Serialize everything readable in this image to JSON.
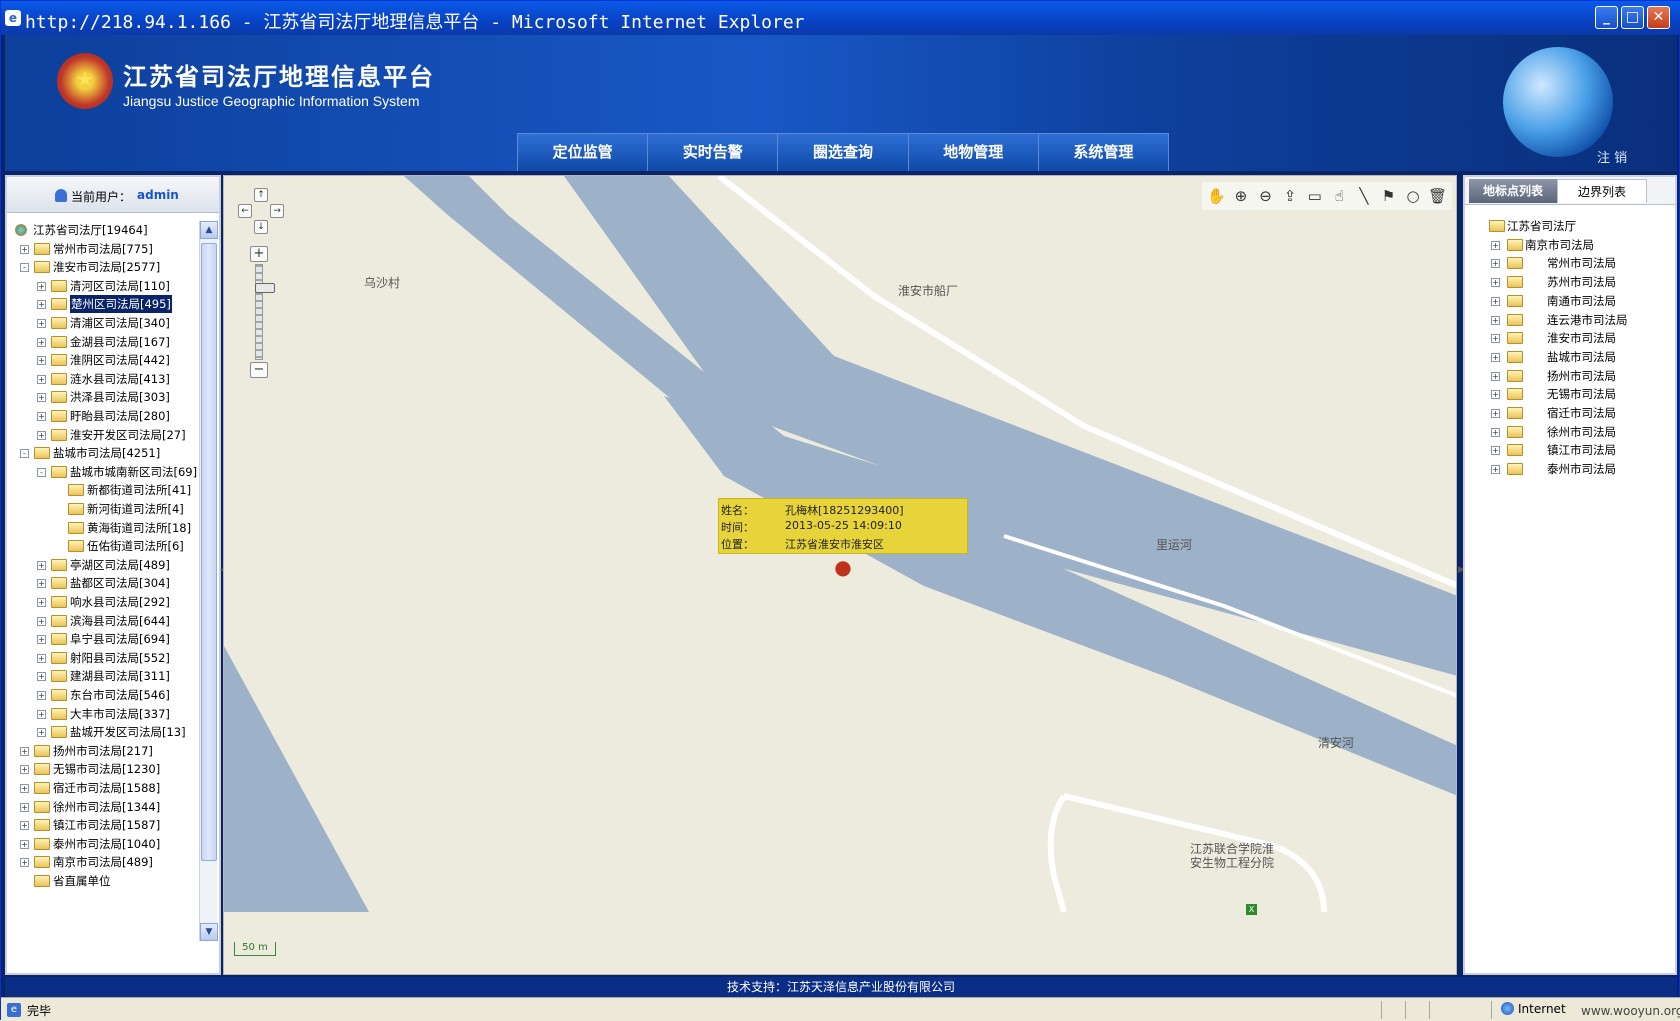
{
  "window": {
    "title": "http://218.94.1.166 - 江苏省司法厅地理信息平台 - Microsoft Internet Explorer",
    "minimize": "_",
    "maximize": "□",
    "close": "✕"
  },
  "header": {
    "title_cn": "江苏省司法厅地理信息平台",
    "title_en": "Jiangsu Justice Geographic Information System",
    "logout": "注 销",
    "emblem_star": "★"
  },
  "nav": {
    "items": [
      "定位监管",
      "实时告警",
      "圈选查询",
      "地物管理",
      "系统管理"
    ]
  },
  "user": {
    "label": "当前用户：",
    "name": "admin"
  },
  "left_tree": {
    "items": [
      {
        "label": "江苏省司法厅[19464]",
        "level": 0,
        "toggle": "",
        "root": true
      },
      {
        "label": "常州市司法局[775]",
        "level": 1,
        "toggle": "+"
      },
      {
        "label": "淮安市司法局[2577]",
        "level": 1,
        "toggle": "-"
      },
      {
        "label": "清河区司法局[110]",
        "level": 2,
        "toggle": "+"
      },
      {
        "label": "楚州区司法局[495]",
        "level": 2,
        "toggle": "+",
        "selected": true
      },
      {
        "label": "清浦区司法局[340]",
        "level": 2,
        "toggle": "+"
      },
      {
        "label": "金湖县司法局[167]",
        "level": 2,
        "toggle": "+"
      },
      {
        "label": "淮阴区司法局[442]",
        "level": 2,
        "toggle": "+"
      },
      {
        "label": "涟水县司法局[413]",
        "level": 2,
        "toggle": "+"
      },
      {
        "label": "洪泽县司法局[303]",
        "level": 2,
        "toggle": "+"
      },
      {
        "label": "盱眙县司法局[280]",
        "level": 2,
        "toggle": "+"
      },
      {
        "label": "淮安开发区司法局[27]",
        "level": 2,
        "toggle": "+"
      },
      {
        "label": "盐城市司法局[4251]",
        "level": 1,
        "toggle": "-"
      },
      {
        "label": "盐城市城南新区司法[69]",
        "level": 2,
        "toggle": "-"
      },
      {
        "label": "新都街道司法所[41]",
        "level": 3,
        "toggle": ""
      },
      {
        "label": "新河街道司法所[4]",
        "level": 3,
        "toggle": ""
      },
      {
        "label": "黄海街道司法所[18]",
        "level": 3,
        "toggle": ""
      },
      {
        "label": "伍佑街道司法所[6]",
        "level": 3,
        "toggle": ""
      },
      {
        "label": "亭湖区司法局[489]",
        "level": 2,
        "toggle": "+"
      },
      {
        "label": "盐都区司法局[304]",
        "level": 2,
        "toggle": "+"
      },
      {
        "label": "响水县司法局[292]",
        "level": 2,
        "toggle": "+"
      },
      {
        "label": "滨海县司法局[644]",
        "level": 2,
        "toggle": "+"
      },
      {
        "label": "阜宁县司法局[694]",
        "level": 2,
        "toggle": "+"
      },
      {
        "label": "射阳县司法局[552]",
        "level": 2,
        "toggle": "+"
      },
      {
        "label": "建湖县司法局[311]",
        "level": 2,
        "toggle": "+"
      },
      {
        "label": "东台市司法局[546]",
        "level": 2,
        "toggle": "+"
      },
      {
        "label": "大丰市司法局[337]",
        "level": 2,
        "toggle": "+"
      },
      {
        "label": "盐城开发区司法局[13]",
        "level": 2,
        "toggle": "+"
      },
      {
        "label": "扬州市司法局[217]",
        "level": 1,
        "toggle": "+"
      },
      {
        "label": "无锡市司法局[1230]",
        "level": 1,
        "toggle": "+"
      },
      {
        "label": "宿迁市司法局[1588]",
        "level": 1,
        "toggle": "+"
      },
      {
        "label": "徐州市司法局[1344]",
        "level": 1,
        "toggle": "+"
      },
      {
        "label": "镇江市司法局[1587]",
        "level": 1,
        "toggle": "+"
      },
      {
        "label": "泰州市司法局[1040]",
        "level": 1,
        "toggle": "+"
      },
      {
        "label": "南京市司法局[489]",
        "level": 1,
        "toggle": "+"
      },
      {
        "label": "省直属单位",
        "level": 1,
        "toggle": ""
      }
    ]
  },
  "map": {
    "labels": {
      "wushacun": "乌沙村",
      "chuanchang": "淮安市船厂",
      "liyunhe": "里运河",
      "qinganhe": "清安河",
      "school1": "江苏联合学院淮",
      "school2": "安生物工程分院"
    },
    "popup": {
      "name_k": "姓名：",
      "name_v": "孔梅林[18251293400]",
      "time_k": "时间：",
      "time_v": "2013-05-25 14:09:10",
      "loc_k": "位置：",
      "loc_v": "江苏省淮安市淮安区"
    },
    "scale": "50 m",
    "tools": [
      "pan-icon",
      "zoom-in-icon",
      "zoom-out-icon",
      "full-extent-icon",
      "measure-icon",
      "select-icon",
      "line-icon",
      "flag-icon",
      "circle-icon",
      "trash-icon"
    ],
    "tool_glyphs": [
      "✋",
      "⊕",
      "⊖",
      "⇪",
      "▭",
      "☝",
      "╲",
      "⚑",
      "○",
      "🗑"
    ],
    "pan": {
      "up": "↑",
      "down": "↓",
      "left": "←",
      "right": "→"
    },
    "zoom": {
      "in": "+",
      "out": "−"
    },
    "colors": {
      "land": "#ecebdd",
      "water": "#9db1c8",
      "road": "#ffffff",
      "popup": "#e6d43a"
    }
  },
  "right_tabs": {
    "active": "地标点列表",
    "inactive": "边界列表"
  },
  "right_tree": {
    "items": [
      {
        "label": "江苏省司法厅",
        "level": 0,
        "toggle": ""
      },
      {
        "label": "南京市司法局",
        "level": 1,
        "toggle": "+"
      },
      {
        "label": "常州市司法局",
        "level": 2,
        "toggle": "+"
      },
      {
        "label": "苏州市司法局",
        "level": 2,
        "toggle": "+"
      },
      {
        "label": "南通市司法局",
        "level": 2,
        "toggle": "+"
      },
      {
        "label": "连云港市司法局",
        "level": 2,
        "toggle": "+"
      },
      {
        "label": "淮安市司法局",
        "level": 2,
        "toggle": "+"
      },
      {
        "label": "盐城市司法局",
        "level": 2,
        "toggle": "+"
      },
      {
        "label": "扬州市司法局",
        "level": 2,
        "toggle": "+"
      },
      {
        "label": "无锡市司法局",
        "level": 2,
        "toggle": "+"
      },
      {
        "label": "宿迁市司法局",
        "level": 2,
        "toggle": "+"
      },
      {
        "label": "徐州市司法局",
        "level": 2,
        "toggle": "+"
      },
      {
        "label": "镇江市司法局",
        "level": 2,
        "toggle": "+"
      },
      {
        "label": "泰州市司法局",
        "level": 2,
        "toggle": "+"
      }
    ]
  },
  "footer": {
    "text": "技术支持：江苏天泽信息产业股份有限公司"
  },
  "status": {
    "text": "完毕",
    "zone": "Internet",
    "watermark": "www.wooyun.org"
  }
}
